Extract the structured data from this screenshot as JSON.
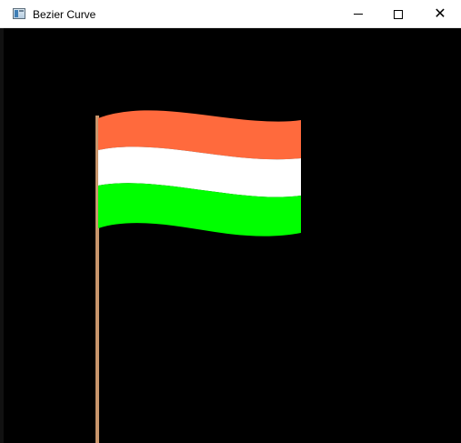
{
  "window": {
    "title": "Bezier Curve",
    "icon": "window-app-icon",
    "controls": {
      "minimize_icon": "minimize-icon",
      "maximize_icon": "maximize-icon",
      "close_icon": "close-icon",
      "close_glyph": "✕"
    }
  },
  "canvas": {
    "background_color": "#000000",
    "pole_color": "#c8956b",
    "stripe_colors": {
      "top": "#ff6a3d",
      "middle": "#ffffff",
      "bottom": "#00ff00"
    }
  }
}
